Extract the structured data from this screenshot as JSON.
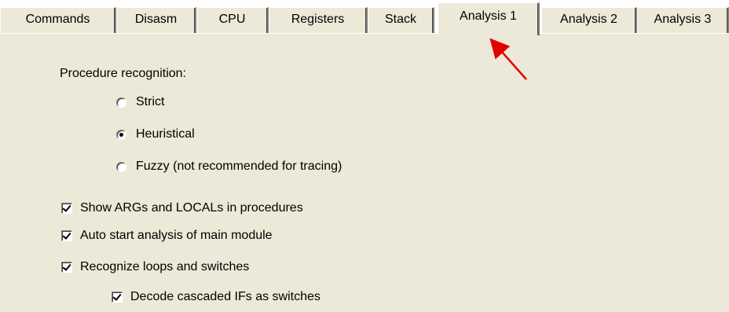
{
  "tabs": [
    {
      "label": "Commands",
      "active": false
    },
    {
      "label": "Disasm",
      "active": false
    },
    {
      "label": "CPU",
      "active": false
    },
    {
      "label": "Registers",
      "active": false
    },
    {
      "label": "Stack",
      "active": false
    },
    {
      "label": "Analysis 1",
      "active": true
    },
    {
      "label": "Analysis 2",
      "active": false
    },
    {
      "label": "Analysis 3",
      "active": false
    }
  ],
  "procedure_recognition": {
    "label": "Procedure recognition:",
    "options": [
      {
        "label": "Strict",
        "checked": false
      },
      {
        "label": "Heuristical",
        "checked": true
      },
      {
        "label": "Fuzzy (not recommended for tracing)",
        "checked": false
      }
    ]
  },
  "checkboxes": [
    {
      "label": "Show ARGs and LOCALs in procedures",
      "checked": true
    },
    {
      "label": "Auto start analysis of main module",
      "checked": true
    },
    {
      "label": "Recognize loops and switches",
      "checked": true
    },
    {
      "label": "Decode cascaded IFs as switches",
      "checked": true
    }
  ],
  "colors": {
    "dialog_background": "#ece9d8",
    "annotation_arrow": "#e00000"
  }
}
